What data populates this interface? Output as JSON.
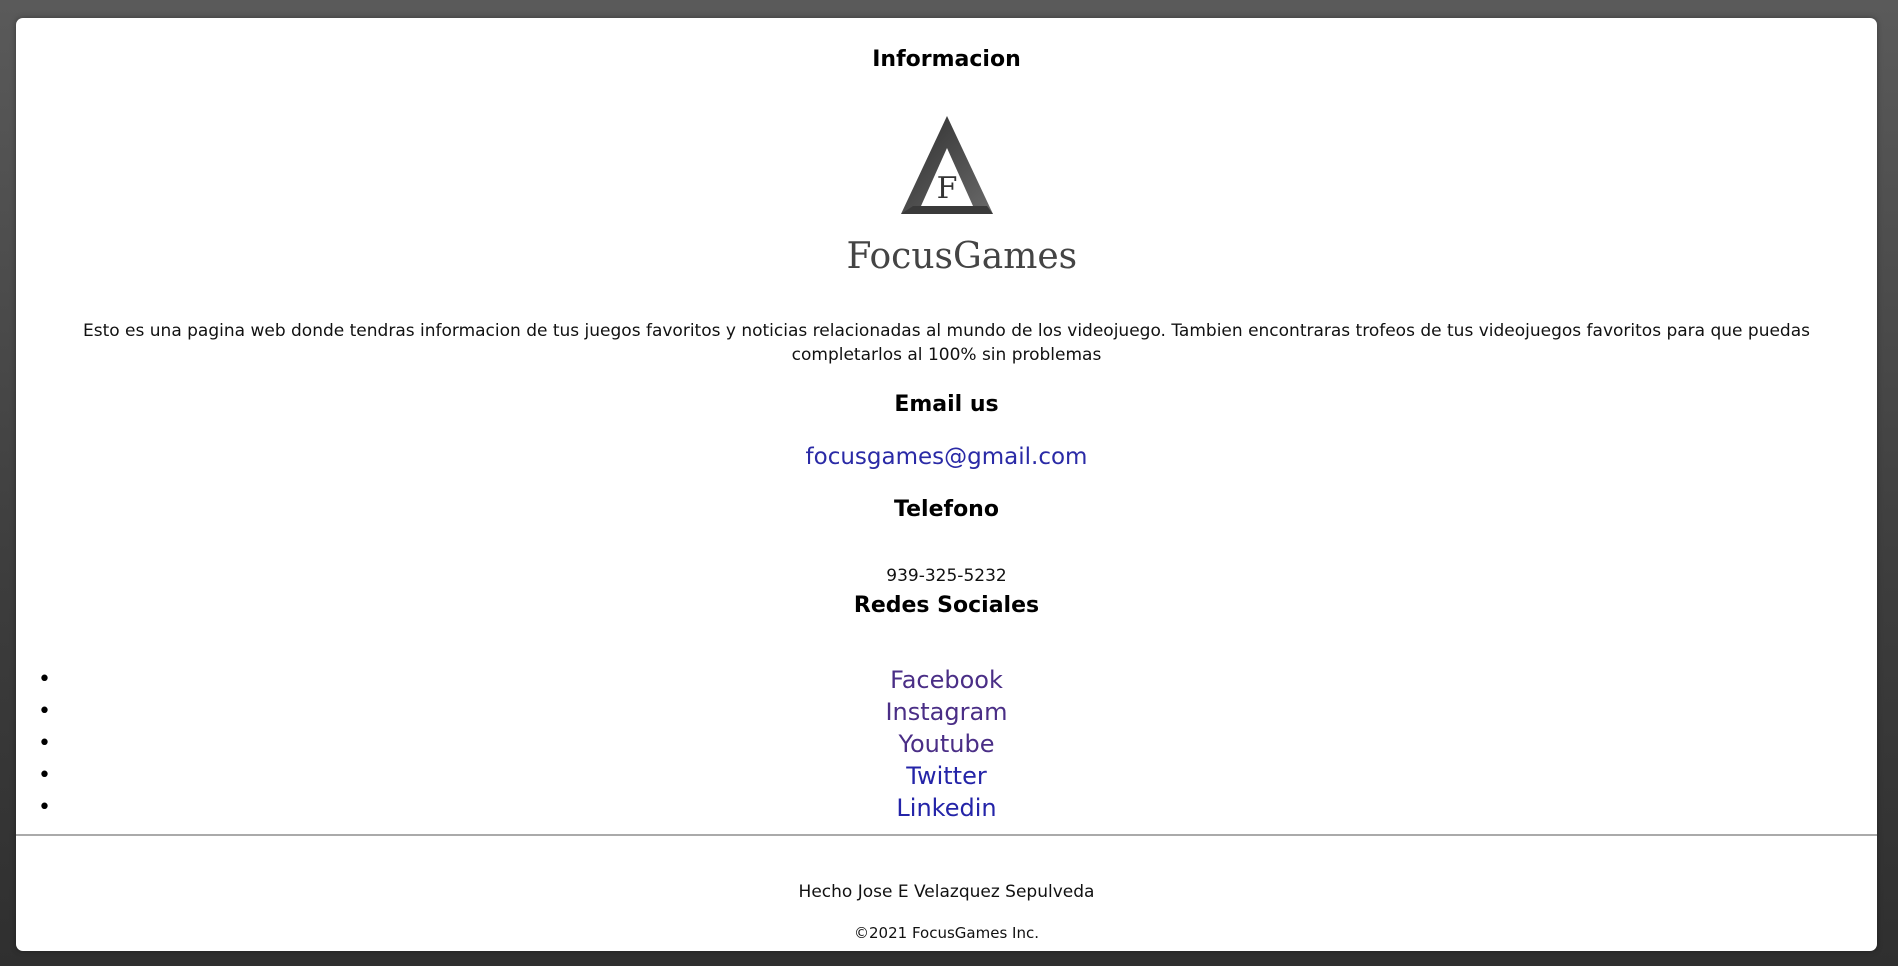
{
  "header": {
    "title": "Informacion"
  },
  "logo": {
    "letter": "F",
    "brand": "FocusGames"
  },
  "description": "Esto es una pagina web donde tendras informacion de tus juegos favoritos y noticias relacionadas al mundo de los videojuego. Tambien encontraras trofeos de tus videojuegos favoritos para que puedas completarlos al 100% sin problemas",
  "email": {
    "heading": "Email us",
    "address": "focusgames@gmail.com"
  },
  "phone": {
    "heading": "Telefono",
    "number": "939-325-5232"
  },
  "social": {
    "heading": "Redes Sociales",
    "bullet": "•",
    "items": [
      {
        "label": "Facebook"
      },
      {
        "label": "Instagram"
      },
      {
        "label": "Youtube"
      },
      {
        "label": "Twitter"
      },
      {
        "label": "Linkedin"
      }
    ]
  },
  "footer": {
    "made_by": "Hecho Jose E Velazquez Sepulveda",
    "copyright": "©2021 FocusGames Inc."
  },
  "colors": {
    "link_unvisited": "#2424a8",
    "link_visited": "#4a2e86",
    "logo_gray": "#444444"
  }
}
